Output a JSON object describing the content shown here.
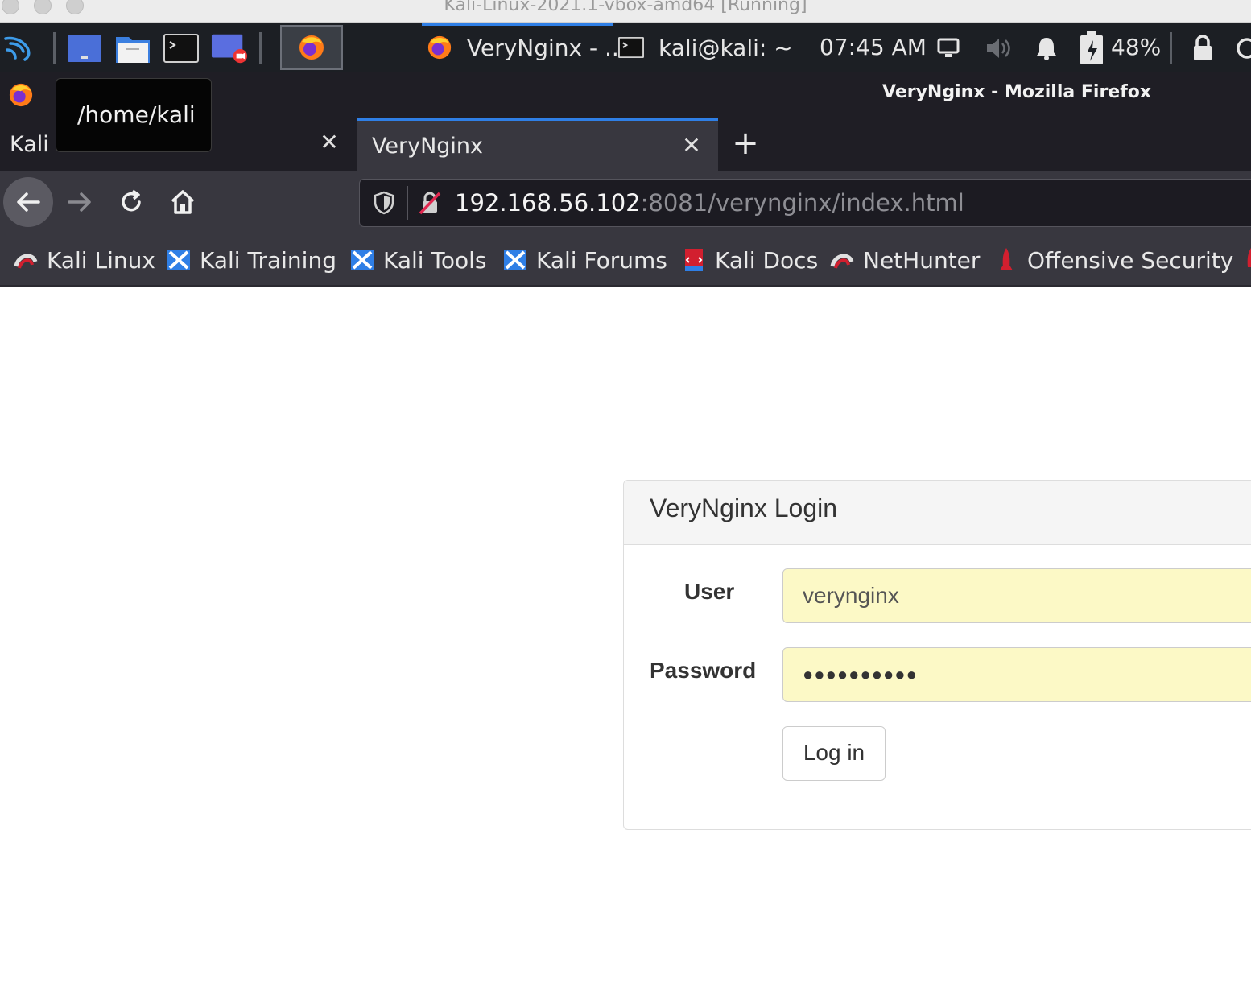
{
  "host_window": {
    "title": "Kali-Linux-2021.1-vbox-amd64 [Running]"
  },
  "panel": {
    "tasks": [
      {
        "label": "VeryNginx - ...",
        "icon": "firefox-icon"
      },
      {
        "label": "kali@kali: ~",
        "icon": "terminal-icon"
      }
    ],
    "clock": "07:45 AM",
    "battery": "48%"
  },
  "firefox": {
    "window_title": "VeryNginx - Mozilla Firefox",
    "tabs": [
      {
        "label": "Kali Linux"
      },
      {
        "label": "VeryNginx"
      }
    ],
    "tooltip": "/home/kali",
    "url": {
      "host": "192.168.56.102",
      "rest": ":8081/verynginx/index.html"
    },
    "bookmarks": [
      {
        "label": "Kali Linux",
        "icon": "kali-dragon-icon"
      },
      {
        "label": "Kali Training",
        "icon": "kali-training-icon"
      },
      {
        "label": "Kali Tools",
        "icon": "kali-tools-icon"
      },
      {
        "label": "Kali Forums",
        "icon": "kali-forums-icon"
      },
      {
        "label": "Kali Docs",
        "icon": "kali-docs-icon"
      },
      {
        "label": "NetHunter",
        "icon": "nethunter-icon"
      },
      {
        "label": "Offensive Security",
        "icon": "offsec-icon"
      }
    ]
  },
  "login": {
    "heading": "VeryNginx Login",
    "user_label": "User",
    "user_value": "verynginx",
    "password_label": "Password",
    "password_value": "●●●●●●●●●●",
    "submit_label": "Log in"
  },
  "colors": {
    "accent": "#2f7fe6",
    "autofill": "#fcf9c6",
    "chrome_dark": "#1f1e25",
    "toolbar": "#38373f"
  }
}
